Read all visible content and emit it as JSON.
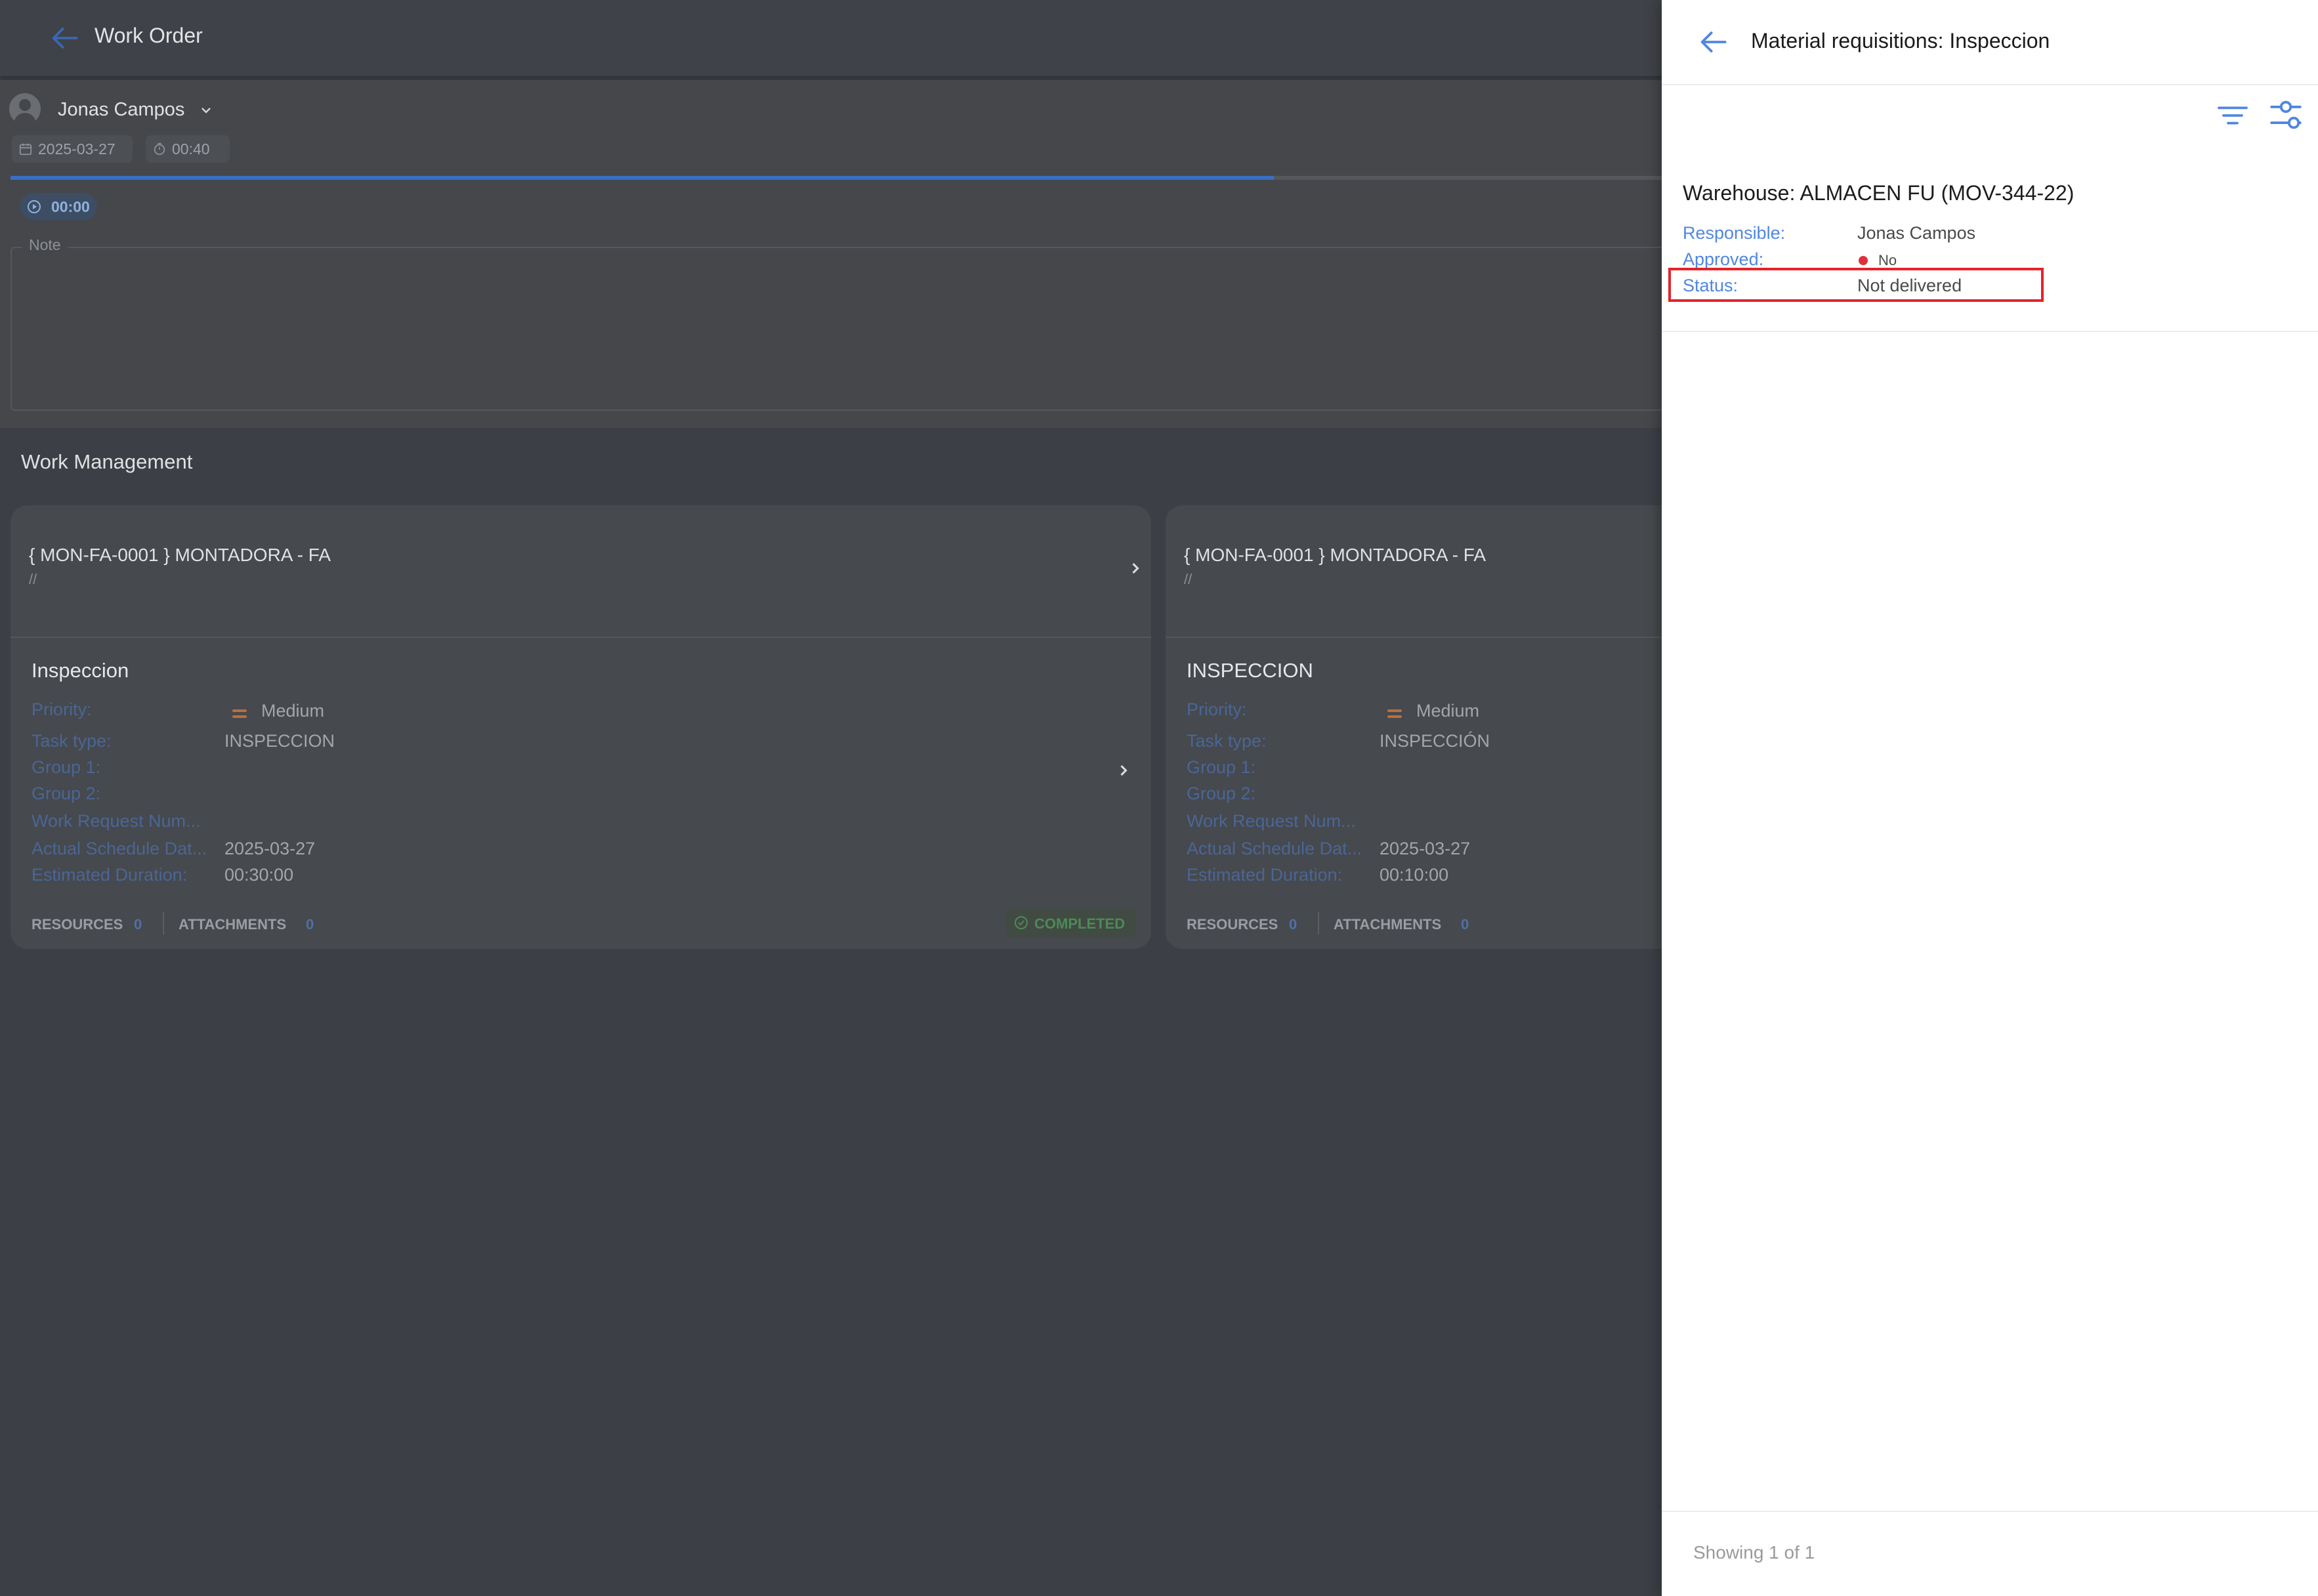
{
  "background": {
    "header": {
      "title": "Work Order"
    },
    "work_order": {
      "user": "Jonas Campos",
      "date": "2025-03-27",
      "time": "00:40",
      "timer": "00:00",
      "note_label": "Note",
      "progress_fraction": 0.55
    },
    "work_management": {
      "title": "Work Management",
      "tasks": [
        {
          "header": "{ MON-FA-0001 } MONTADORA - FA",
          "subheader": "//",
          "title": "Inspeccion",
          "priority_label": "Priority:",
          "priority": "Medium",
          "task_type_label": "Task type:",
          "task_type": "INSPECCION",
          "group1_label": "Group 1:",
          "group2_label": "Group 2:",
          "work_request_label": "Work Request Num...",
          "actual_schedule_label": "Actual Schedule Dat...",
          "actual_schedule": "2025-03-27",
          "est_duration_label": "Estimated Duration:",
          "est_duration": "00:30:00",
          "resources_label": "RESOURCES",
          "resources_count": "0",
          "attachments_label": "ATTACHMENTS",
          "attachments_count": "0",
          "status": "COMPLETED"
        },
        {
          "header": "{ MON-FA-0001 } MONTADORA - FA",
          "subheader": "//",
          "title": "INSPECCION",
          "priority_label": "Priority:",
          "priority": "Medium",
          "task_type_label": "Task type:",
          "task_type": "INSPECCIÓN",
          "group1_label": "Group 1:",
          "group2_label": "Group 2:",
          "work_request_label": "Work Request Num...",
          "actual_schedule_label": "Actual Schedule Dat...",
          "actual_schedule": "2025-03-27",
          "est_duration_label": "Estimated Duration:",
          "est_duration": "00:10:00",
          "resources_label": "RESOURCES",
          "resources_count": "0",
          "attachments_label": "ATTACHMENTS",
          "attachments_count": "0"
        }
      ]
    }
  },
  "drawer": {
    "title": "Material requisitions: Inspeccion",
    "icons": [
      "back-arrow-icon",
      "filter-icon",
      "tune-icon"
    ],
    "requisition": {
      "warehouse": "Warehouse: ALMACEN FU (MOV-344-22)",
      "responsible_label": "Responsible:",
      "responsible": "Jonas Campos",
      "approved_label": "Approved:",
      "approved": "No",
      "status_label": "Status:",
      "status": "Not delivered"
    },
    "footer": {
      "showing": "Showing 1 of 1"
    }
  },
  "colors": {
    "accent": "#4f87e0",
    "not_approved_dot": "#e0303a",
    "highlight_box": "#e3242b",
    "overlay_bg": "#3c4046"
  }
}
